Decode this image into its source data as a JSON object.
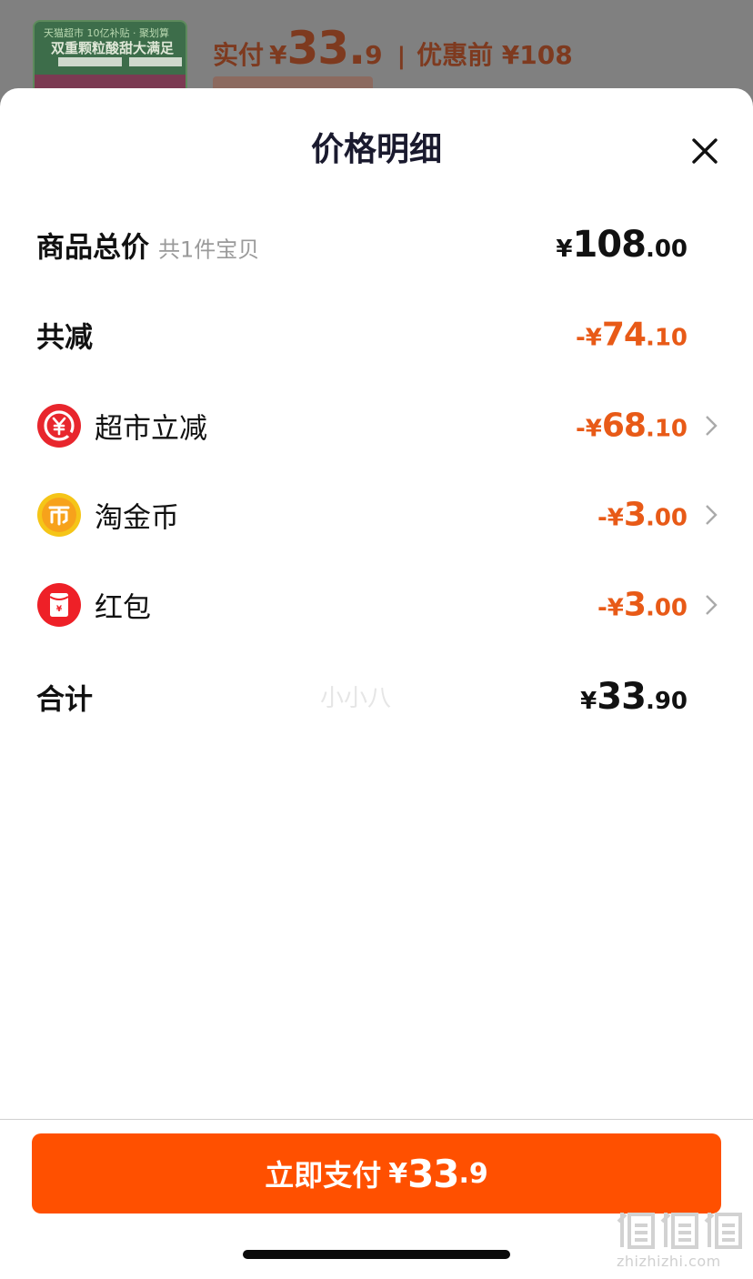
{
  "background_order": {
    "thumb_line1": "天猫超市 10亿补贴 · 聚划算",
    "thumb_line2": "双重颗粒酸甜大满足",
    "paid_label": "实付",
    "paid_currency": "¥",
    "paid_integer": "33.",
    "paid_decimal": "9",
    "separator": "|",
    "original_price": "优惠前 ¥108"
  },
  "sheet": {
    "title": "价格明细",
    "close_icon": "close-icon"
  },
  "rows": {
    "total": {
      "label": "商品总价",
      "sub": "共1件宝贝",
      "currency": "¥",
      "integer": "108",
      "decimal": ".00"
    },
    "discount": {
      "label": "共减",
      "currency": "-¥",
      "integer": "74",
      "decimal": ".10"
    },
    "supermarket": {
      "label": "超市立减",
      "currency": "-¥",
      "integer": "68",
      "decimal": ".10",
      "icon": "yuan-coupon-icon"
    },
    "coins": {
      "label": "淘金币",
      "currency": "-¥",
      "integer": "3",
      "decimal": ".00",
      "icon": "gold-coin-icon"
    },
    "redpacket": {
      "label": "红包",
      "currency": "-¥",
      "integer": "3",
      "decimal": ".00",
      "icon": "red-packet-icon"
    },
    "sum": {
      "label": "合计",
      "currency": "¥",
      "integer": "33",
      "decimal": ".90"
    }
  },
  "watermark": "小小八",
  "pay_button": {
    "label": "立即支付",
    "currency": "¥",
    "integer": "33",
    "decimal": ".9"
  },
  "site": {
    "domain": "zhizhizhi.com"
  },
  "colors": {
    "accent_orange": "#ff5000",
    "discount_text": "#e85a17",
    "title": "#1a1a2e"
  }
}
